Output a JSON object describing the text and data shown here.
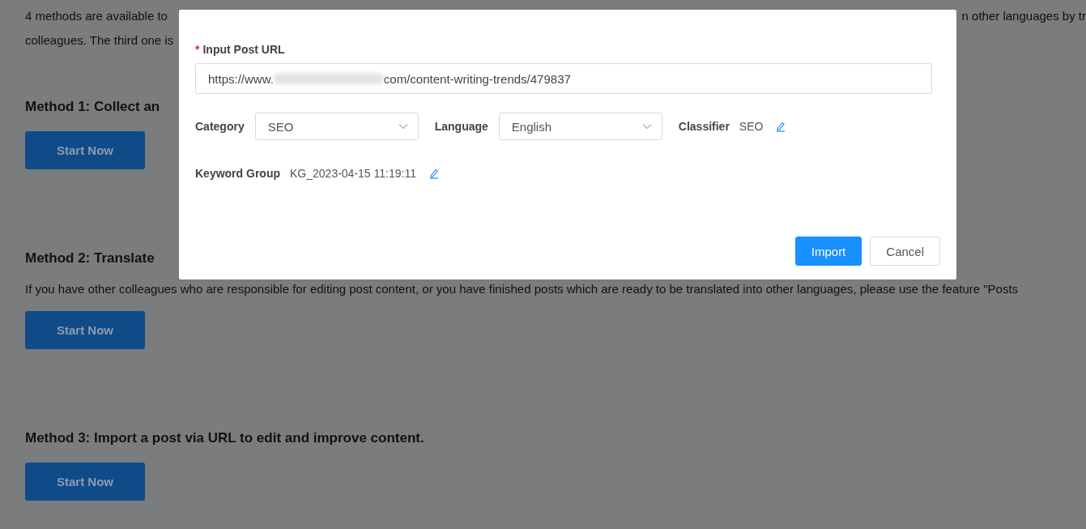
{
  "page": {
    "intro_line_1_left": "4 methods are available to",
    "intro_line_1_right": "n other languages by tr",
    "intro_line_2_left": "colleagues. The third one is",
    "methods": [
      {
        "title": "Method 1: Collect an",
        "button": "Start Now"
      },
      {
        "title": "Method 2:  Translate",
        "description": "If you have other colleagues who are responsible for editing post content, or you have finished posts which are ready to be translated into other languages, please use the feature \"Posts",
        "button": "Start Now"
      },
      {
        "title": "Method 3: Import a post via URL to edit and improve content.",
        "button": "Start Now"
      }
    ]
  },
  "dialog": {
    "url_field": {
      "required_mark": "*",
      "label": "Input Post URL",
      "value_start": "https://www.",
      "value_end": "com/content-writing-trends/479837"
    },
    "category": {
      "label": "Category",
      "value": "SEO"
    },
    "language": {
      "label": "Language",
      "value": "English"
    },
    "classifier": {
      "label": "Classifier",
      "value": "SEO"
    },
    "keyword_group": {
      "label": "Keyword Group",
      "value": "KG_2023-04-15 11:19:11"
    },
    "buttons": [
      {
        "label": "Import",
        "primary": true
      },
      {
        "label": "Cancel",
        "primary": false
      }
    ]
  }
}
